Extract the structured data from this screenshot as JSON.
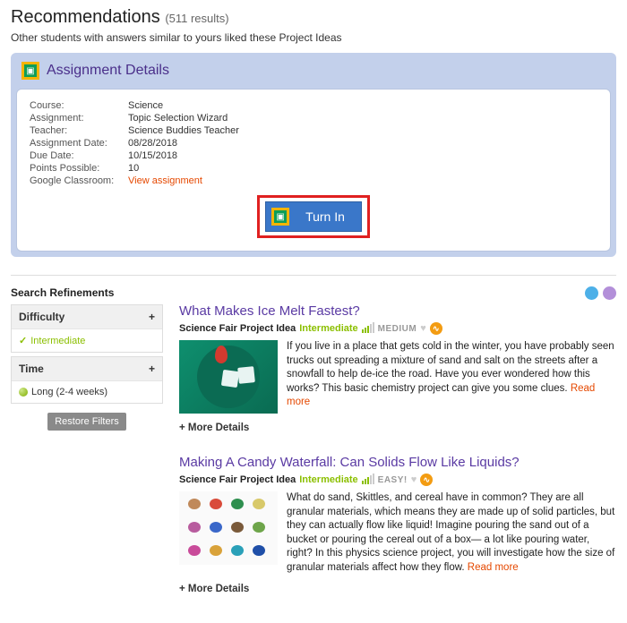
{
  "header": {
    "title": "Recommendations",
    "count": "(511 results)",
    "subhead": "Other students with answers similar to yours liked these Project Ideas"
  },
  "assignment": {
    "panel_title": "Assignment Details",
    "rows": {
      "course_k": "Course:",
      "course_v": "Science",
      "assign_k": "Assignment:",
      "assign_v": "Topic Selection Wizard",
      "teacher_k": "Teacher:",
      "teacher_v": "Science Buddies Teacher",
      "adate_k": "Assignment Date:",
      "adate_v": "08/28/2018",
      "due_k": "Due Date:",
      "due_v": "10/15/2018",
      "pts_k": "Points Possible:",
      "pts_v": "10",
      "gc_k": "Google Classroom:",
      "gc_link": "View assignment"
    },
    "turn_in": "Turn In"
  },
  "filters": {
    "heading": "Search Refinements",
    "difficulty": {
      "label": "Difficulty",
      "value": "Intermediate"
    },
    "time": {
      "label": "Time",
      "value": "Long (2-4 weeks)"
    },
    "restore": "Restore Filters"
  },
  "results": [
    {
      "title": "What Makes Ice Melt Fastest?",
      "kind": "Science Fair Project Idea",
      "difficulty": "Intermediate",
      "time": "MEDIUM",
      "desc": "If you live in a place that gets cold in the winter, you have probably seen trucks out spreading a mixture of sand and salt on the streets after a snowfall to help de-ice the road. Have you ever wondered how this works? This basic chemistry project can give you some clues. ",
      "readmore": "Read more",
      "more": "+ More Details"
    },
    {
      "title": "Making A Candy Waterfall: Can Solids Flow Like Liquids?",
      "kind": "Science Fair Project Idea",
      "difficulty": "Intermediate",
      "time": "EASY!",
      "desc": "What do sand, Skittles, and cereal have in common? They are all granular materials, which means they are made up of solid particles, but they can actually flow like liquid! Imagine pouring the sand out of a bucket or pouring the cereal out of a box— a lot like pouring water, right? In this physics science project, you will investigate how the size of granular materials affect how they flow. ",
      "readmore": "Read more",
      "more": "+ More Details"
    }
  ]
}
